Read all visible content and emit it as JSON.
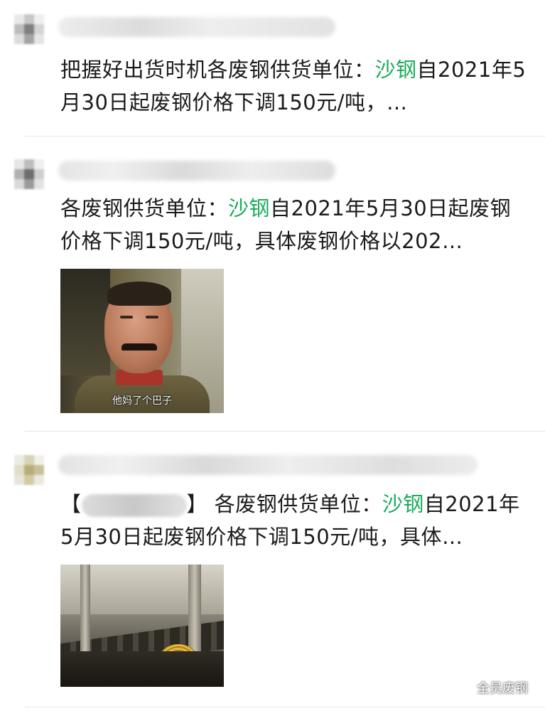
{
  "posts": [
    {
      "text_prefix": "把握好出货时机各废钢供货单位：",
      "keyword": "沙钢",
      "text_suffix": "自2021年5月30日起废钢价格下调150元/吨，…"
    },
    {
      "text_prefix": "各废钢供货单位：",
      "keyword": "沙钢",
      "text_suffix": "自2021年5月30日起废钢价格下调150元/吨，具体废钢价格以202…",
      "image_caption": "他妈了个巴子"
    },
    {
      "bracket_open": "【",
      "bracket_close": "】",
      "text_prefix": "各废钢供货单位：",
      "keyword": "沙钢",
      "text_suffix": "自2021年5月30日起废钢价格下调150元/吨，具体…"
    }
  ],
  "watermark": {
    "icon": "wechat-icon",
    "label": "全员废钢"
  },
  "colors": {
    "keyword": "#1aad5a",
    "text": "#1b1b1b",
    "divider": "#e6e6e6"
  }
}
